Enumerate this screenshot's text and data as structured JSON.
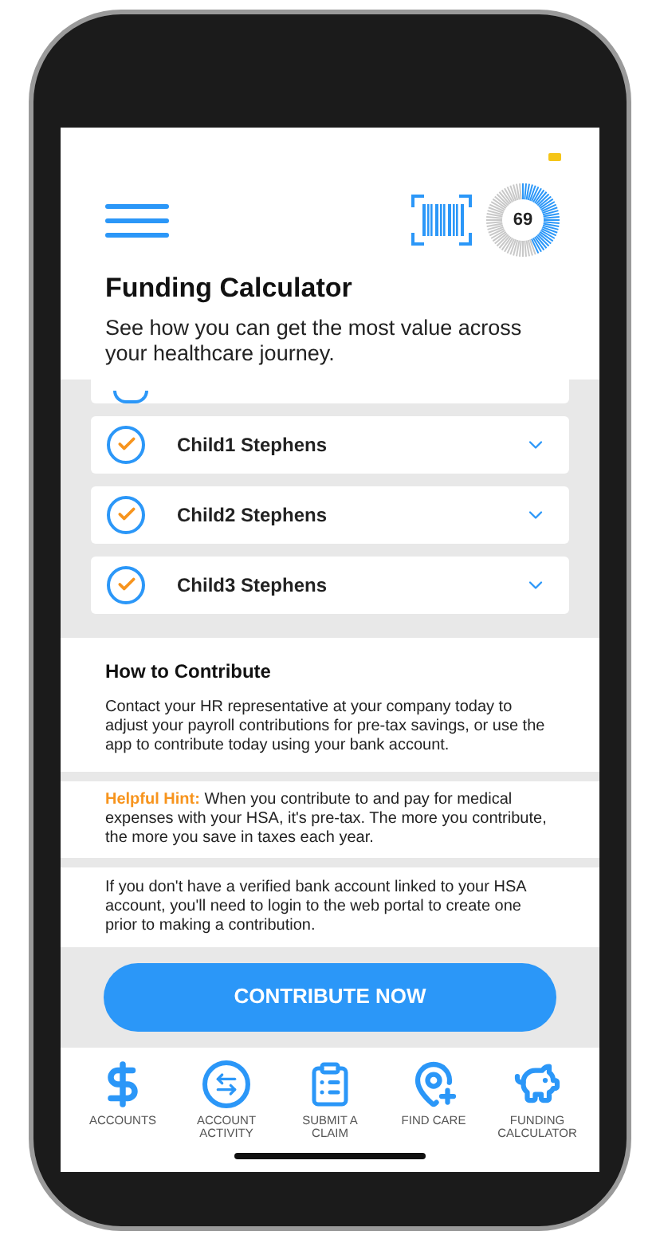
{
  "header": {
    "score": {
      "value": "69"
    }
  },
  "title": "Funding Calculator",
  "subtitle": "See how you can get the most value across your healthcare journey.",
  "members": [
    {
      "name": "Child1 Stephens",
      "checked": true,
      "expanded": false
    },
    {
      "name": "Child2 Stephens",
      "checked": true,
      "expanded": false
    },
    {
      "name": "Child3 Stephens",
      "checked": true,
      "expanded": false
    }
  ],
  "how_to_contribute": {
    "heading": "How to Contribute",
    "text": "Contact your HR representative at your company today to adjust your payroll contributions for pre-tax savings, or use the app to contribute today using your bank account."
  },
  "hint": {
    "label": "Helpful Hint:",
    "text": "When you contribute to and pay for medical expenses with your HSA, it's pre-tax. The more you contribute, the more you save in taxes each year."
  },
  "bank_note": "If you don't have a verified bank account linked to your HSA account, you'll need to login to the web portal to create one prior to making a contribution.",
  "contribute_button": "CONTRIBUTE NOW",
  "nav": [
    {
      "kind": "dollar",
      "label": "ACCOUNTS"
    },
    {
      "kind": "activity",
      "label": "ACCOUNT ACTIVITY"
    },
    {
      "kind": "claim",
      "label": "SUBMIT A CLAIM"
    },
    {
      "kind": "care",
      "label": "FIND CARE"
    },
    {
      "kind": "piggy",
      "label": "FUNDING CALCULATOR"
    }
  ]
}
